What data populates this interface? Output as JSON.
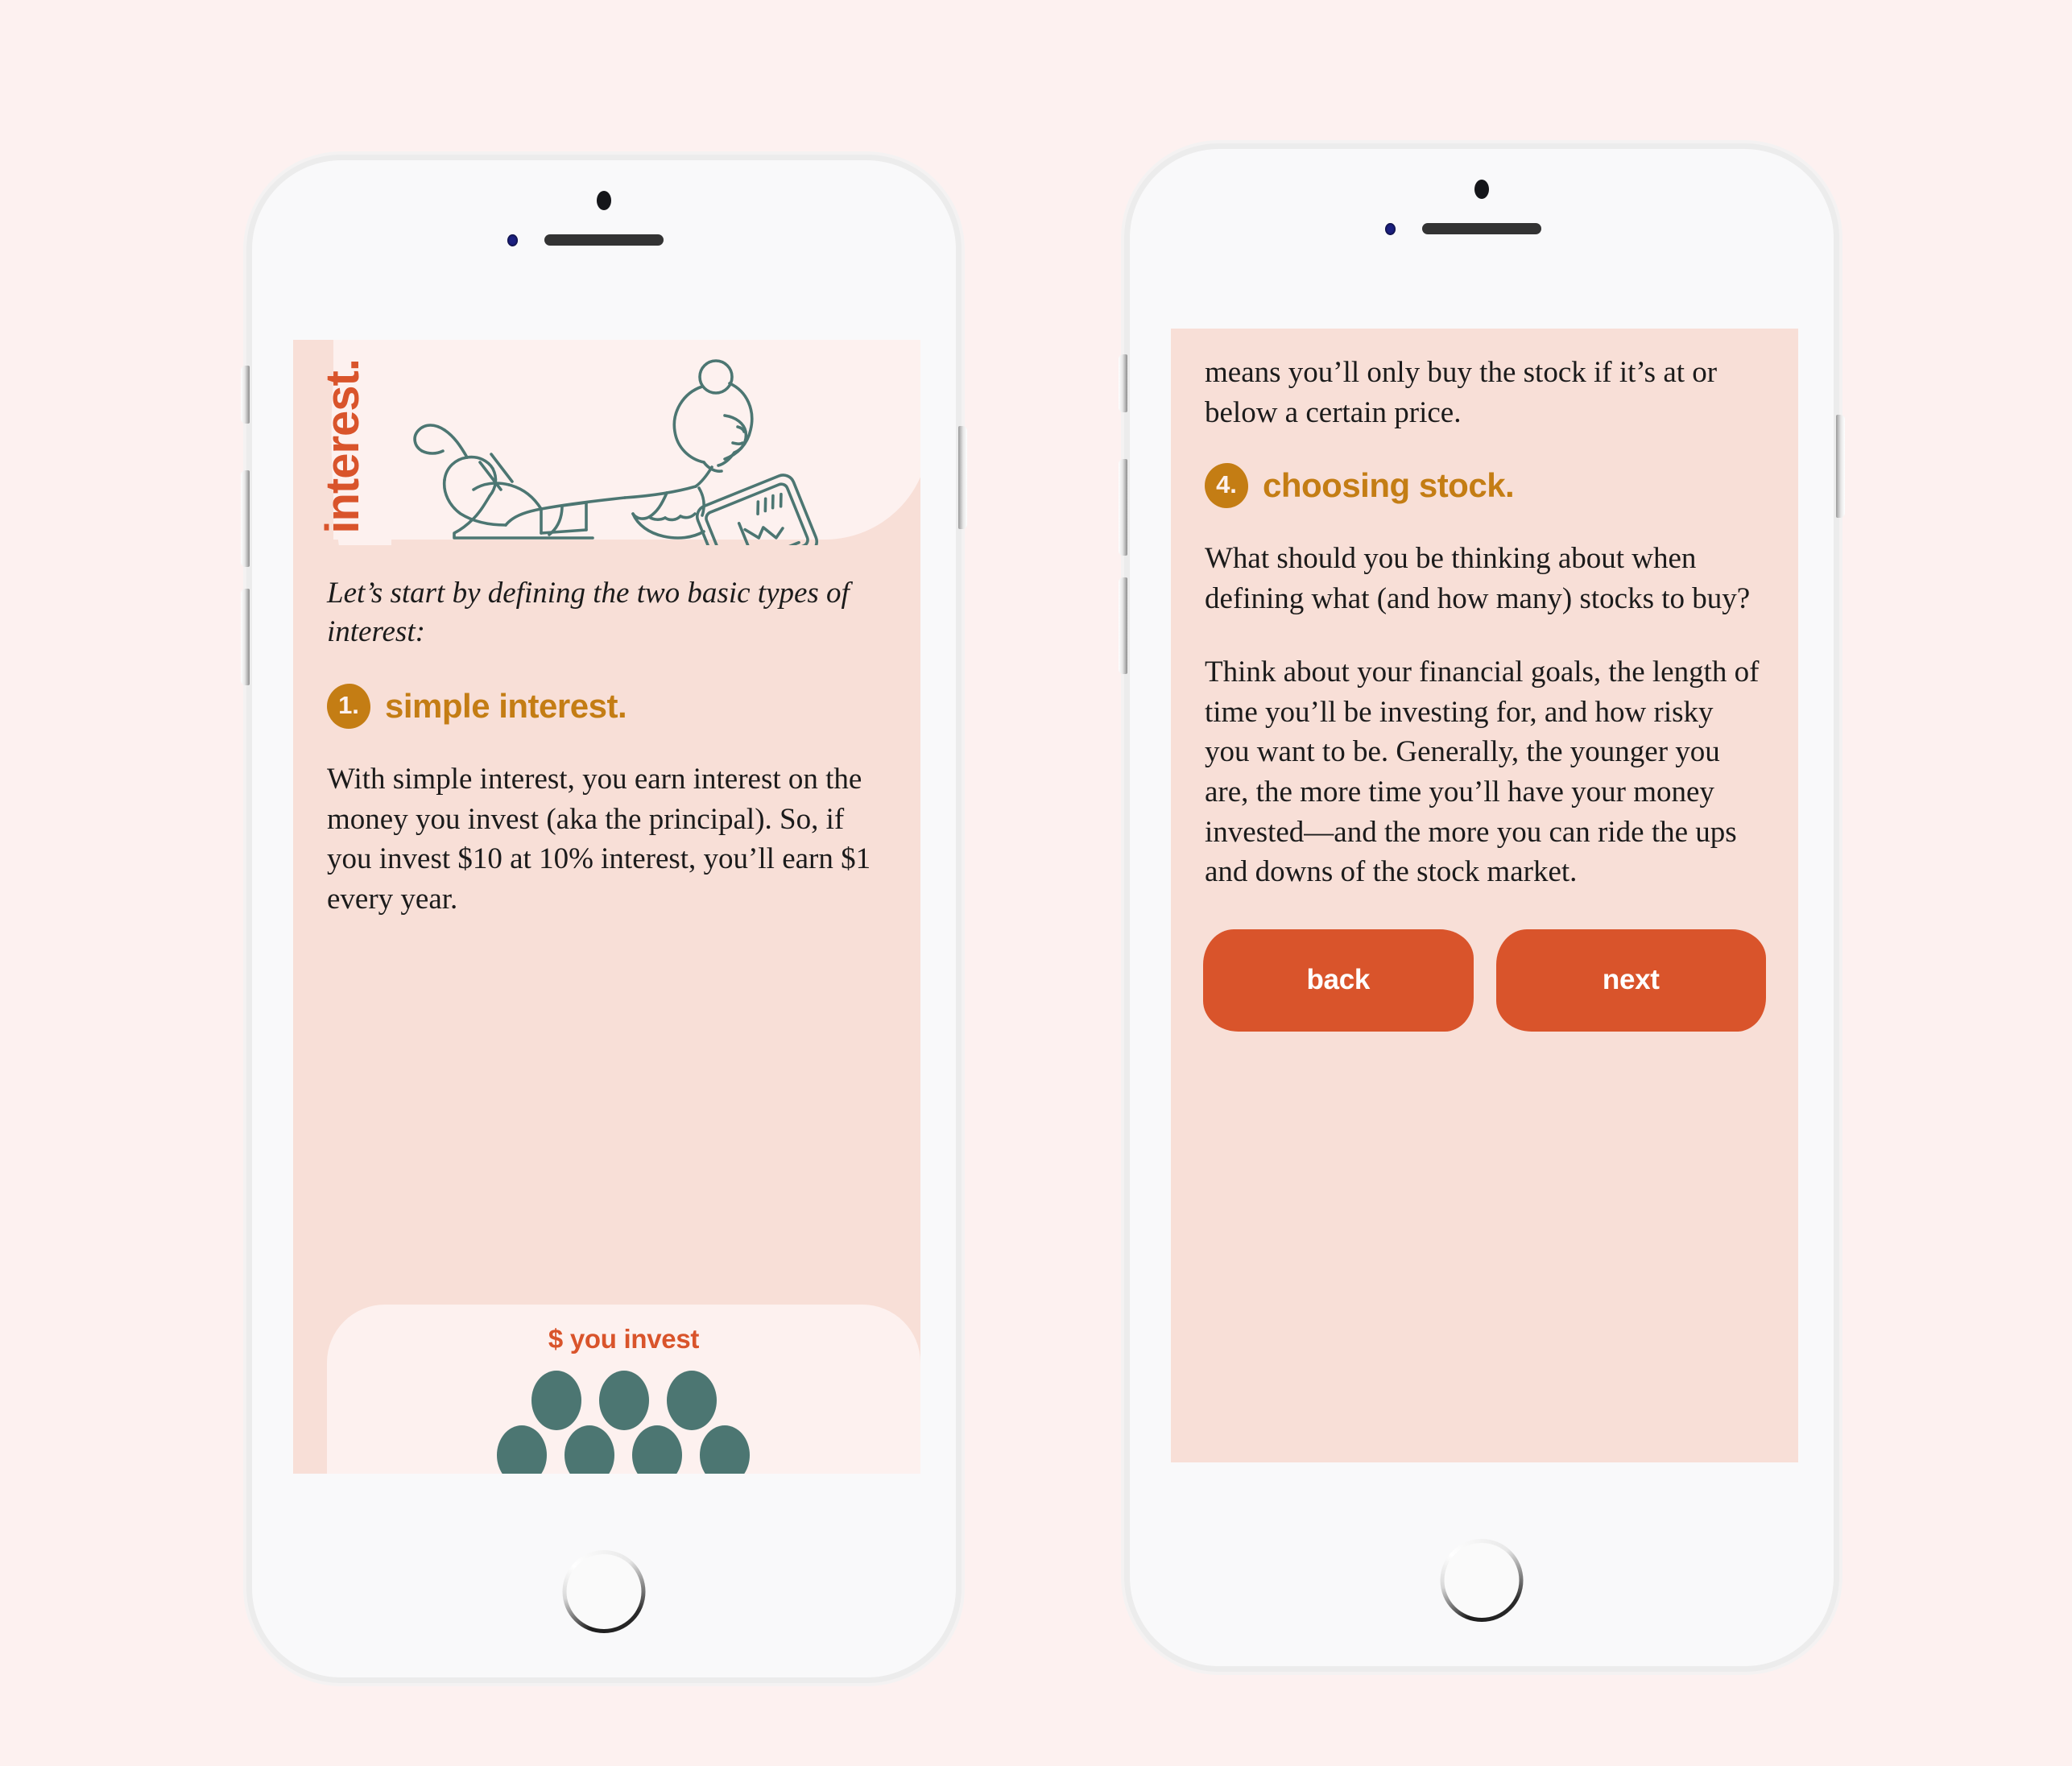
{
  "page": {
    "background_color": "#fdf1f0"
  },
  "theme": {
    "screen_bg": "#f8dfd7",
    "card_bg": "#fdf1ef",
    "accent_orange": "#d9542b",
    "accent_gold": "#c47d14",
    "teal": "#4c7672",
    "body_text": "#1b1b1b"
  },
  "phones": [
    {
      "id": "phone-left",
      "hardware": {
        "camera": "camera-dot",
        "speaker": "speaker-grille",
        "sensor": "proximity-sensor",
        "home_button": "home-button"
      },
      "screen": {
        "hero": {
          "title": "interest.",
          "illustration": "woman-reading-tablet-illustration"
        },
        "intro": "Let’s start by defining the two basic types of interest:",
        "section": {
          "badge": "1.",
          "heading": "simple interest."
        },
        "body": "With simple interest, you earn interest on the money you invest (aka the principal). So, if you invest $10 at 10% interest, you’ll earn $1 every year.",
        "invest_panel": {
          "label": "$ you invest",
          "coins_row_1": 3,
          "coins_row_2": 4
        }
      }
    },
    {
      "id": "phone-right",
      "hardware": {
        "camera": "camera-dot",
        "speaker": "speaker-grille",
        "sensor": "proximity-sensor",
        "home_button": "home-button"
      },
      "screen": {
        "continued_text": "means you’ll only buy the stock if it’s at or below a certain price.",
        "section": {
          "badge": "4.",
          "heading": "choosing stock."
        },
        "paragraph_1": "What should you be thinking about when defining what (and how many) stocks to buy?",
        "paragraph_2": "Think about your financial goals, the length of time you’ll be investing for, and how risky you want to be. Generally, the younger you are, the more time you’ll have your money invested—and the more you can ride the ups and downs of the stock market.",
        "buttons": {
          "back": "back",
          "next": "next"
        }
      }
    }
  ]
}
